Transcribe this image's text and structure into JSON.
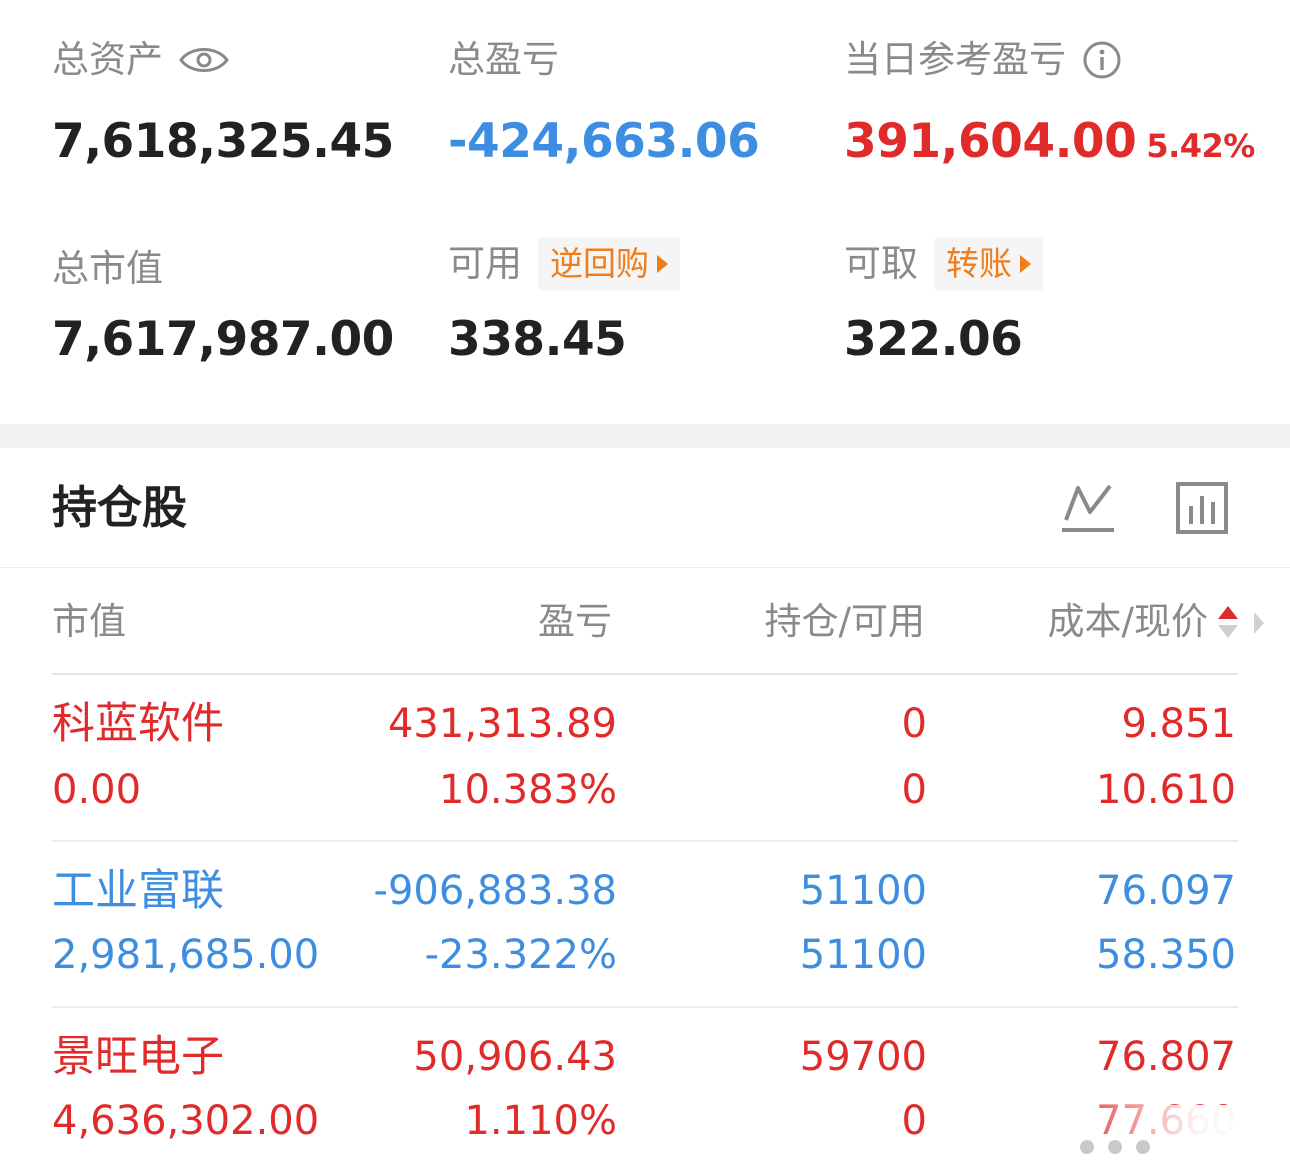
{
  "summary": {
    "total_assets": {
      "label": "总资产",
      "value": "7,618,325.45",
      "icon": "eye-icon"
    },
    "total_pnl": {
      "label": "总盈亏",
      "value": "-424,663.06"
    },
    "daily_pnl": {
      "label": "当日参考盈亏",
      "value": "391,604.00",
      "percent": "5.42%",
      "icon": "info-icon"
    },
    "market_value": {
      "label": "总市值",
      "value": "7,617,987.00"
    },
    "available": {
      "label": "可用",
      "tag": "逆回购",
      "value": "338.45"
    },
    "withdrawable": {
      "label": "可取",
      "tag": "转账",
      "value": "322.06"
    }
  },
  "holdings": {
    "title": "持仓股",
    "columns": [
      "市值",
      "盈亏",
      "持仓/可用",
      "成本/现价"
    ],
    "rows": [
      {
        "name": "科蓝软件",
        "market_value": "0.00",
        "pnl": "431,313.89",
        "pnl_pct": "10.383%",
        "position": "0",
        "available": "0",
        "cost": "9.851",
        "price": "10.610",
        "color": "red"
      },
      {
        "name": "工业富联",
        "market_value": "2,981,685.00",
        "pnl": "-906,883.38",
        "pnl_pct": "-23.322%",
        "position": "51100",
        "available": "51100",
        "cost": "76.097",
        "price": "58.350",
        "color": "blue"
      },
      {
        "name": "景旺电子",
        "market_value": "4,636,302.00",
        "pnl": "50,906.43",
        "pnl_pct": "1.110%",
        "position": "59700",
        "available": "0",
        "cost": "76.807",
        "price": "77.660",
        "color": "red"
      }
    ]
  },
  "colors": {
    "red": "#e12b2b",
    "blue": "#3d8ee0",
    "orange": "#f07d1a",
    "label": "#8a8a8a"
  }
}
